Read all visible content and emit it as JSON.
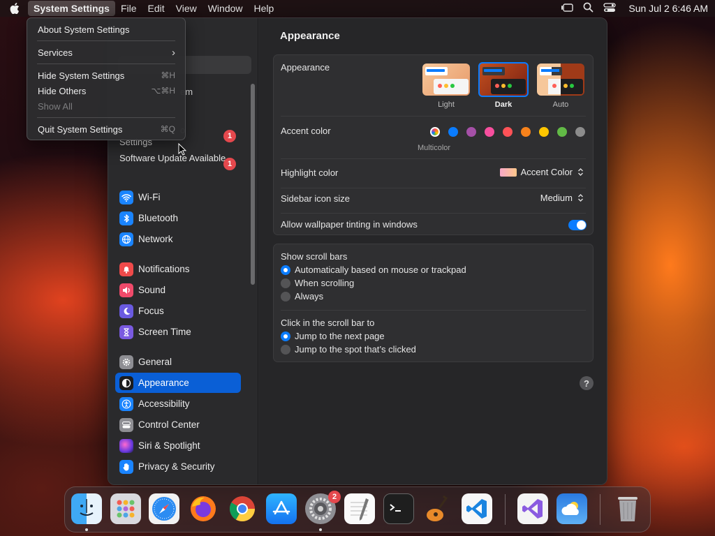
{
  "menubar": {
    "app_name": "System Settings",
    "menus": [
      "File",
      "Edit",
      "View",
      "Window",
      "Help"
    ],
    "clock": "Sun Jul 2  6:46 AM"
  },
  "app_menu": {
    "items": [
      {
        "label": "About System Settings",
        "shortcut": ""
      },
      {
        "label": "Services",
        "shortcut": "›"
      },
      {
        "label": "Hide System Settings",
        "shortcut": "⌘H"
      },
      {
        "label": "Hide Others",
        "shortcut": "⌥⌘H"
      },
      {
        "label": "Show All",
        "shortcut": ""
      },
      {
        "label": "Quit System Settings",
        "shortcut": "⌘Q"
      }
    ]
  },
  "sidebar": {
    "partial_labels": [
      "em",
      "o",
      "Settings"
    ],
    "software_update": {
      "label": "Software Update Available",
      "badge": "1"
    },
    "settings_badge": "1",
    "items": [
      {
        "label": "Wi-Fi",
        "icon": "wifi-icon",
        "color": "#1a84ff"
      },
      {
        "label": "Bluetooth",
        "icon": "bluetooth-icon",
        "color": "#1a84ff"
      },
      {
        "label": "Network",
        "icon": "globe-icon",
        "color": "#1a84ff"
      },
      {
        "label": "Notifications",
        "icon": "bell-icon",
        "color": "#f04a4a"
      },
      {
        "label": "Sound",
        "icon": "speaker-icon",
        "color": "#f04a6a"
      },
      {
        "label": "Focus",
        "icon": "moon-icon",
        "color": "#6a5ae0"
      },
      {
        "label": "Screen Time",
        "icon": "hourglass-icon",
        "color": "#7a5ae0"
      },
      {
        "label": "General",
        "icon": "gear-icon",
        "color": "#8e8e93"
      },
      {
        "label": "Appearance",
        "icon": "appearance-icon",
        "color": "#1c1c1e"
      },
      {
        "label": "Accessibility",
        "icon": "accessibility-icon",
        "color": "#1a84ff"
      },
      {
        "label": "Control Center",
        "icon": "control-center-icon",
        "color": "#8e8e93"
      },
      {
        "label": "Siri & Spotlight",
        "icon": "siri-icon",
        "color": "#c04ae0"
      },
      {
        "label": "Privacy & Security",
        "icon": "hand-icon",
        "color": "#1a84ff"
      }
    ]
  },
  "main": {
    "title": "Appearance",
    "appearance": {
      "label": "Appearance",
      "options": [
        "Light",
        "Dark",
        "Auto"
      ],
      "selected": "Dark"
    },
    "accent": {
      "label": "Accent color",
      "selected_name": "Multicolor",
      "colors": [
        "#0a7cff",
        "#a550a7",
        "#f74f9e",
        "#ff5257",
        "#f7821b",
        "#ffc600",
        "#62ba46",
        "#8c8c8c"
      ]
    },
    "highlight": {
      "label": "Highlight color",
      "value": "Accent Color"
    },
    "sidebar_icon_size": {
      "label": "Sidebar icon size",
      "value": "Medium"
    },
    "wallpaper_tinting": {
      "label": "Allow wallpaper tinting in windows",
      "on": true
    },
    "scroll_bars": {
      "label": "Show scroll bars",
      "options": [
        "Automatically based on mouse or trackpad",
        "When scrolling",
        "Always"
      ],
      "selected_index": 0
    },
    "click_scroll": {
      "label": "Click in the scroll bar to",
      "options": [
        "Jump to the next page",
        "Jump to the spot that’s clicked"
      ],
      "selected_index": 0
    },
    "help": "?"
  },
  "dock": {
    "apps": [
      "Finder",
      "Launchpad",
      "Safari",
      "Firefox",
      "Chrome",
      "App Store",
      "System Settings",
      "TextEdit",
      "Terminal",
      "GarageBand",
      "VS Code",
      "Visual Studio",
      "Weather",
      "Trash"
    ],
    "settings_badge": "2"
  }
}
